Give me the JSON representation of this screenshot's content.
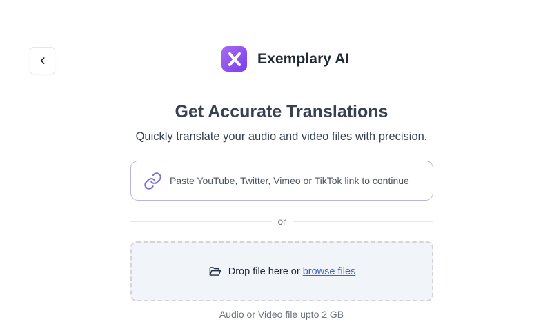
{
  "brand": {
    "name": "Exemplary AI",
    "icon": "x-logo-icon",
    "accent": "#8b5cf6"
  },
  "nav": {
    "back_icon": "chevron-left-icon"
  },
  "hero": {
    "title": "Get Accurate Translations",
    "subtitle": "Quickly translate your audio and video files with precision."
  },
  "link_input": {
    "icon": "link-icon",
    "value": "",
    "placeholder": "Paste YouTube, Twitter, Vimeo or TikTok link to continue",
    "border_color": "#b9b3dd"
  },
  "divider": {
    "label": "or"
  },
  "dropzone": {
    "icon": "folder-open-icon",
    "text": "Drop file here or",
    "browse_label": "browse files",
    "link_color": "#3b62d9"
  },
  "note": "Audio or Video file upto 2 GB"
}
